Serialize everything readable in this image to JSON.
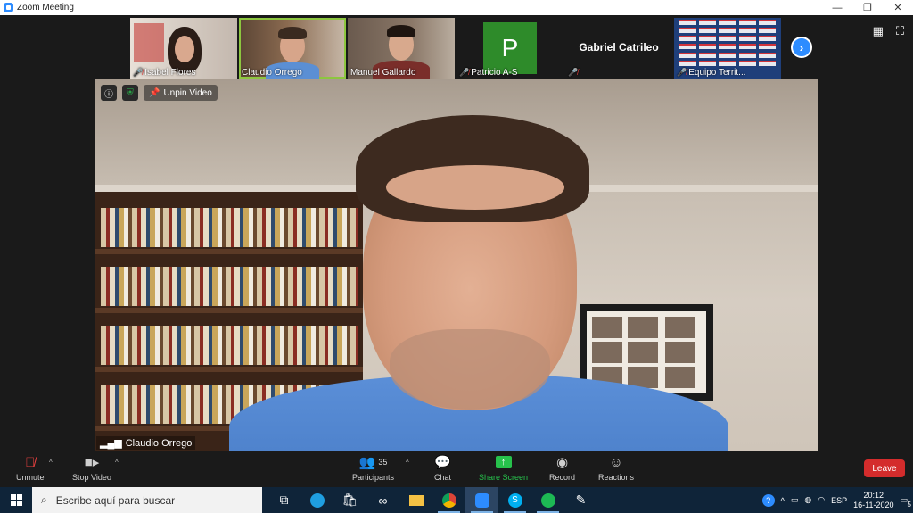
{
  "window": {
    "title": "Zoom Meeting",
    "controls": [
      "—",
      "❐",
      "✕"
    ]
  },
  "participants_strip": [
    {
      "name": "Isabel Flores",
      "muted": true
    },
    {
      "name": "Claudio Orrego",
      "muted": false,
      "active": true
    },
    {
      "name": "Manuel Gallardo",
      "muted": false
    },
    {
      "name": "Patricio A-S",
      "muted": true,
      "avatar_letter": "P",
      "avatar_color": "#2e8b2a"
    },
    {
      "name": "Gabriel Catrileo",
      "muted": true
    },
    {
      "name": "Equipo Territ...",
      "muted": true
    }
  ],
  "main_video": {
    "speaker_name": "Claudio Orrego",
    "unpin_label": "Unpin Video"
  },
  "toolbar": {
    "unmute": "Unmute",
    "stop_video": "Stop Video",
    "participants": "Participants",
    "participants_count": "35",
    "chat": "Chat",
    "share_screen": "Share Screen",
    "record": "Record",
    "reactions": "Reactions",
    "leave": "Leave"
  },
  "taskbar": {
    "search_placeholder": "Escribe aquí para buscar",
    "language": "ESP",
    "time": "20:12",
    "date": "16-11-2020",
    "notifications": "5"
  },
  "colors": {
    "zoom_blue": "#2d8cff",
    "share_green": "#27c24c",
    "leave_red": "#d42c2c",
    "active_outline": "#8dc63f"
  }
}
